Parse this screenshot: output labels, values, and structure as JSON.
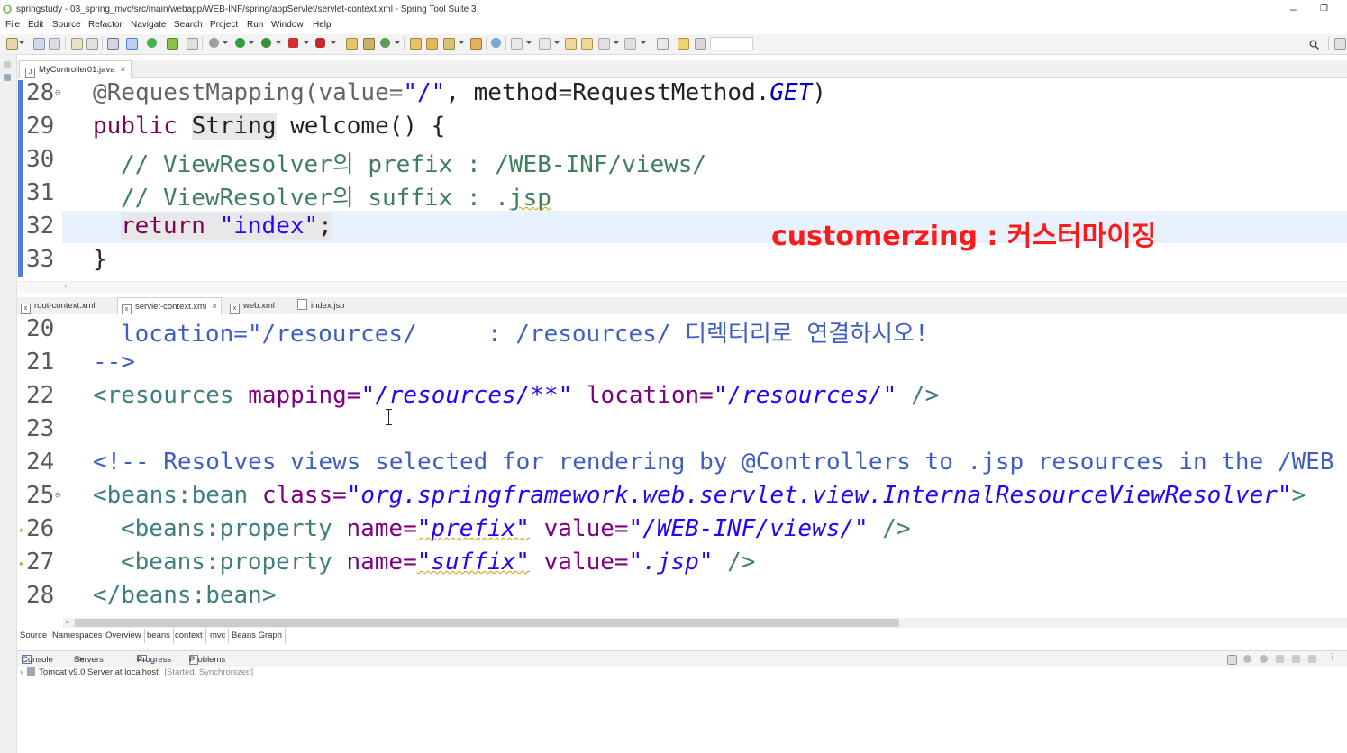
{
  "window": {
    "title": "springstudy - 03_spring_mvc/src/main/webapp/WEB-INF/spring/appServlet/servlet-context.xml - Spring Tool Suite 3",
    "minimize": "–",
    "restore": "❐"
  },
  "menu": [
    "File",
    "Edit",
    "Source",
    "Refactor",
    "Navigate",
    "Search",
    "Project",
    "Run",
    "Window",
    "Help"
  ],
  "top_editor": {
    "tab": "MyController01.java",
    "lines": [
      {
        "num": "28",
        "text": "@RequestMapping(value=\"/\", method=RequestMethod.GET)"
      },
      {
        "num": "29",
        "text": "public String welcome() {"
      },
      {
        "num": "30",
        "text": "// ViewResolver의 prefix : /WEB-INF/views/"
      },
      {
        "num": "31",
        "text": "// ViewResolver의 suffix : .jsp"
      },
      {
        "num": "32",
        "text": "return \"index\";"
      },
      {
        "num": "33",
        "text": "}"
      }
    ],
    "tokens": {
      "l28_anno": "@RequestMapping(value=",
      "l28_str": "\"/\"",
      "l28_mid": ", method=RequestMethod.",
      "l28_get": "GET",
      "l28_end": ")",
      "l29_public": "public",
      "l29_string": "String",
      "l29_rest": " welcome() {",
      "l30": "// ViewResolver의 prefix : /WEB-INF/views/",
      "l31_a": "// ViewResolver의 suffix : .",
      "l31_b": "jsp",
      "l32_return": "return",
      "l32_str": "\"index\"",
      "l32_end": ";",
      "l33": "}"
    }
  },
  "annotation": "customerzing : 커스터마이징",
  "xml_tabs": [
    "root-context.xml",
    "servlet-context.xml",
    "web.xml",
    "index.jsp"
  ],
  "bottom_editor": {
    "lines": {
      "n20": "20",
      "n21": "21",
      "n22": "22",
      "n23": "23",
      "n24": "24",
      "n25": "25",
      "n26": "26",
      "n27": "27",
      "n28": "28"
    },
    "t20": "location=\"/resources/     : /resources/ 디렉터리로 연결하시오!",
    "t21": "-->",
    "t22_tag": "<resources",
    "t22_attr1": " mapping=",
    "t22_val1": "\"/resources/**\"",
    "t22_attr2": " location=",
    "t22_val2": "\"/resources/\"",
    "t22_end": " />",
    "t24": "<!-- Resolves views selected for rendering by @Controllers to .jsp resources in the /WEB",
    "t25_tag": "<beans:bean",
    "t25_attr": " class=",
    "t25_val": "\"org.springframework.web.servlet.view.InternalResourceViewResolver\"",
    "t25_end": ">",
    "t26_tag": "<beans:property",
    "t26_attr1": " name=",
    "t26_val1": "\"prefix\"",
    "t26_attr2": " value=",
    "t26_val2": "\"/WEB-INF/views/\"",
    "t26_end": " />",
    "t27_tag": "<beans:property",
    "t27_attr1": " name=",
    "t27_val1": "\"suffix\"",
    "t27_attr2": " value=",
    "t27_val2": "\".jsp\"",
    "t27_end": " />",
    "t28": "</beans:bean>"
  },
  "source_tabs": [
    "Source",
    "Namespaces",
    "Overview",
    "beans",
    "context",
    "mvc",
    "Beans Graph"
  ],
  "console_tabs": [
    "Console",
    "Servers",
    "Progress",
    "Problems"
  ],
  "server": {
    "name": "Tomcat v9.0 Server at localhost",
    "status": "[Started, Synchronized]"
  },
  "colors": {
    "keyword": "#7f0055",
    "string": "#2a00ff",
    "comment": "#3f7f5f",
    "annotation": "#ff1a1a",
    "marker": "#4a7fd6"
  }
}
